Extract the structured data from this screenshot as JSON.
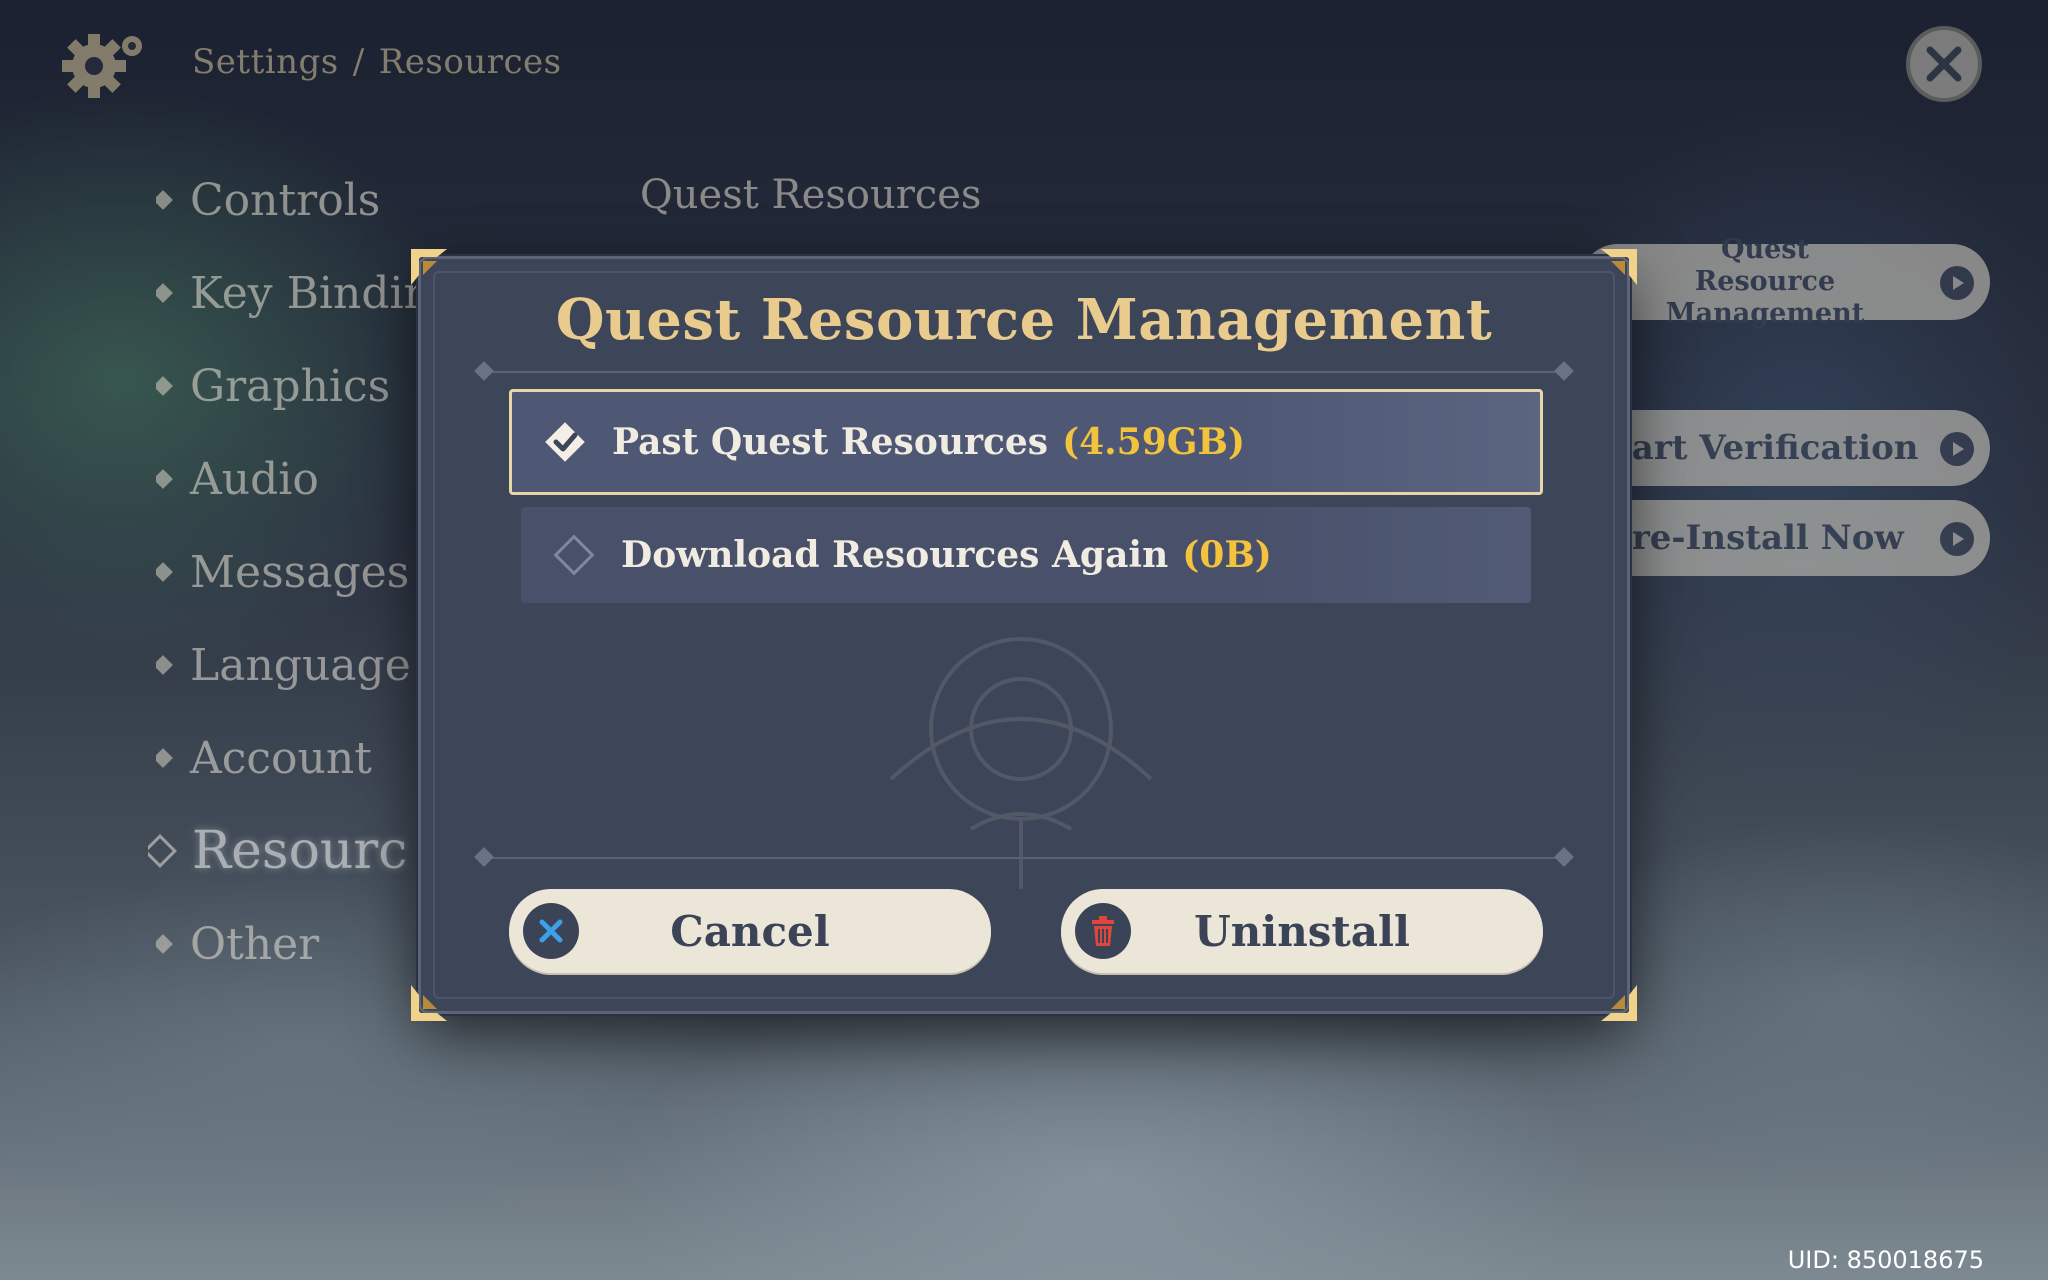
{
  "header": {
    "breadcrumb": [
      "Settings",
      "/",
      "Resources"
    ],
    "gear_icon": "gear-icon",
    "close_icon": "close-icon"
  },
  "sidebar": {
    "items": [
      {
        "label": "Controls"
      },
      {
        "label": "Key Bindin"
      },
      {
        "label": "Graphics"
      },
      {
        "label": "Audio"
      },
      {
        "label": "Messages"
      },
      {
        "label": "Language"
      },
      {
        "label": "Account"
      },
      {
        "label": "Resourc",
        "active": true
      },
      {
        "label": "Other"
      }
    ]
  },
  "main": {
    "section_title": "Quest Resources",
    "buttons": {
      "quest_resource_management": "Quest Resource Management",
      "start_verification": "Start Verification",
      "pre_install_now": "Pre-Install Now"
    }
  },
  "dialog": {
    "title": "Quest Resource Management",
    "options": [
      {
        "label": "Past Quest Resources",
        "size": "(4.59GB)",
        "selected": true
      },
      {
        "label": "Download Resources Again",
        "size": "(0B)",
        "selected": false
      }
    ],
    "cancel_label": "Cancel",
    "uninstall_label": "Uninstall"
  },
  "footer": {
    "uid": "UID: 850018675"
  },
  "colors": {
    "accent_gold": "#e8cb8d",
    "size_yellow": "#f4c33e",
    "dialog_bg": "#3d4559",
    "button_bg": "#ece6d9",
    "cancel_icon_blue": "#3aa0e8",
    "uninstall_icon_red": "#e0463c"
  }
}
